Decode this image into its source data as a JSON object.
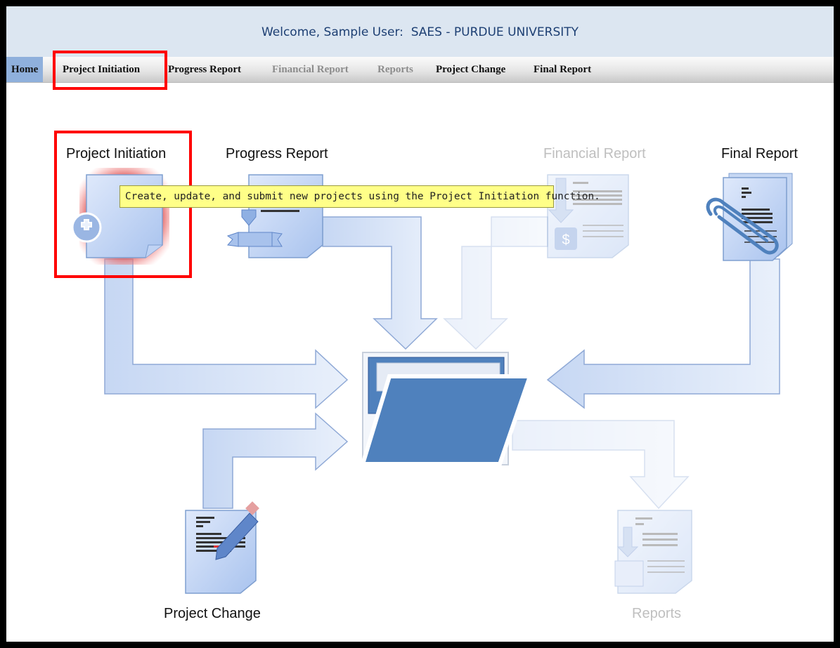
{
  "header": {
    "welcome_prefix": "Welcome, Sample User:",
    "organization": "SAES - PURDUE UNIVERSITY"
  },
  "nav": {
    "items": [
      {
        "label": "Home",
        "enabled": true
      },
      {
        "label": "Project Initiation",
        "enabled": true
      },
      {
        "label": "Progress Report",
        "enabled": true
      },
      {
        "label": "Financial Report",
        "enabled": false
      },
      {
        "label": "Reports",
        "enabled": false
      },
      {
        "label": "Project Change",
        "enabled": true
      },
      {
        "label": "Final Report",
        "enabled": true
      }
    ]
  },
  "diagram": {
    "project_initiation": "Project Initiation",
    "progress_report": "Progress Report",
    "financial_report": "Financial Report",
    "final_report": "Final Report",
    "project_change": "Project Change",
    "reports": "Reports",
    "dollar_symbol": "$"
  },
  "tooltip": {
    "text": "Create, update, and submit new projects using the Project Initiation function."
  },
  "colors": {
    "highlight_box": "#ff0000",
    "header_bg": "#dce6f1",
    "header_text": "#1d3f73",
    "tooltip_bg": "#ffff88",
    "folder_blue": "#4f81bd"
  }
}
